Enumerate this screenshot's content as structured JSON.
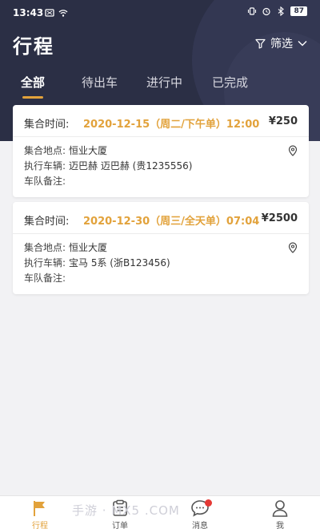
{
  "status_bar": {
    "time": "13:43",
    "battery": "87"
  },
  "header": {
    "title": "行程",
    "filter_label": "筛选"
  },
  "tabs": [
    {
      "label": "全部",
      "active": true
    },
    {
      "label": "待出车",
      "active": false
    },
    {
      "label": "进行中",
      "active": false
    },
    {
      "label": "已完成",
      "active": false
    }
  ],
  "orders": [
    {
      "time_label": "集合时间:",
      "time_value": "2020-12-15（周二/下午单）12:00",
      "price": "¥250",
      "location_label": "集合地点:",
      "location_value": "恒业大厦",
      "vehicle_label": "执行车辆:",
      "vehicle_value": "迈巴赫 迈巴赫 (贵1235556)",
      "remark_label": "车队备注:",
      "remark_value": ""
    },
    {
      "time_label": "集合时间:",
      "time_value": "2020-12-30（周三/全天单）07:04",
      "price": "¥2500",
      "location_label": "集合地点:",
      "location_value": "恒业大厦",
      "vehicle_label": "执行车辆:",
      "vehicle_value": "宝马 5系 (浙B123456)",
      "remark_label": "车队备注:",
      "remark_value": ""
    }
  ],
  "tabbar": [
    {
      "label": "行程",
      "icon": "flag-icon",
      "active": true
    },
    {
      "label": "订单",
      "icon": "clipboard-icon",
      "active": false
    },
    {
      "label": "消息",
      "icon": "chat-icon",
      "active": false,
      "badge": true
    },
    {
      "label": "我",
      "icon": "user-icon",
      "active": false
    }
  ],
  "watermark": "手游 · MX5 .COM",
  "colors": {
    "header_bg": "#2b2f45",
    "accent": "#e2a23b",
    "badge": "#e53935"
  }
}
